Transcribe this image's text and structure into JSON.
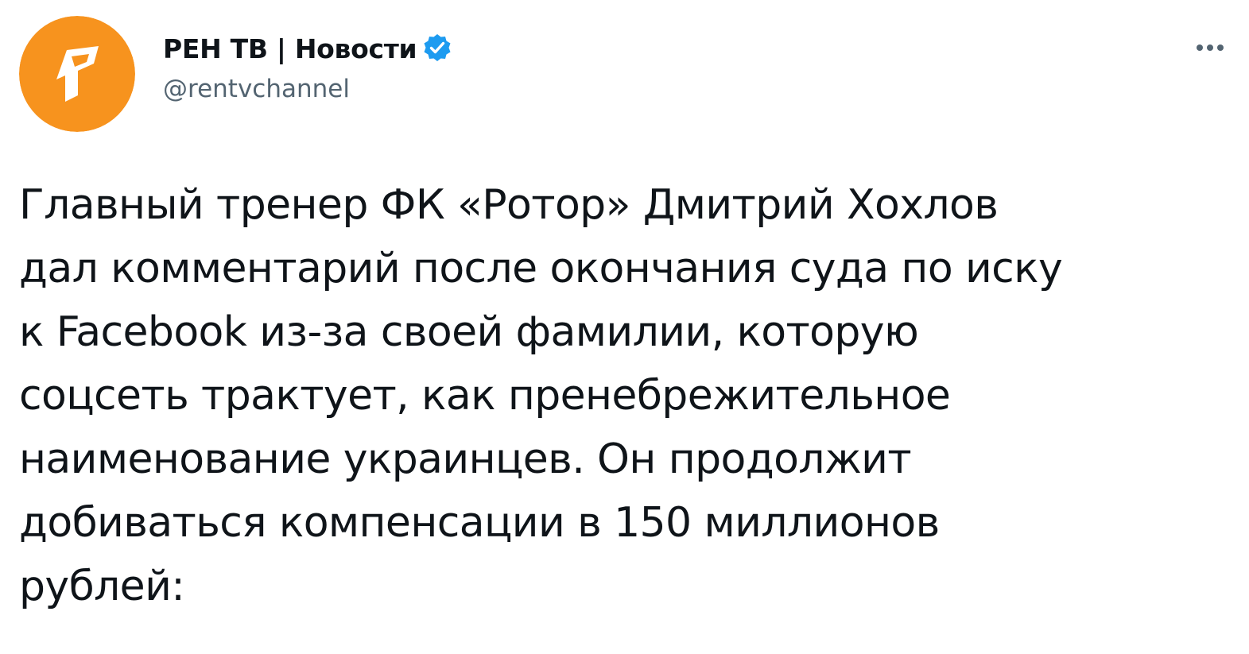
{
  "author": {
    "display_name": "РЕН ТВ | Новости",
    "handle": "@rentvchannel",
    "verified": true,
    "avatar": {
      "icon": "ren-tv-logo-icon",
      "background_color": "#f7931e",
      "glyph_color": "#ffffff"
    }
  },
  "menu": {
    "icon": "more-dots-icon"
  },
  "tweet": {
    "text": "Главный тренер ФК «Ротор» Дмитрий Хохлов\nдал комментарий после окончания суда по иску\nк Facebook из-за своей фамилии, которую\nсоцсеть трактует, как пренебрежительное\nнаименование украинцев. Он продолжит\nдобиваться компенсации в 150 миллионов\nрублей:"
  },
  "colors": {
    "verified_badge": "#1d9bf0",
    "handle": "#536471",
    "text": "#0f1419"
  }
}
